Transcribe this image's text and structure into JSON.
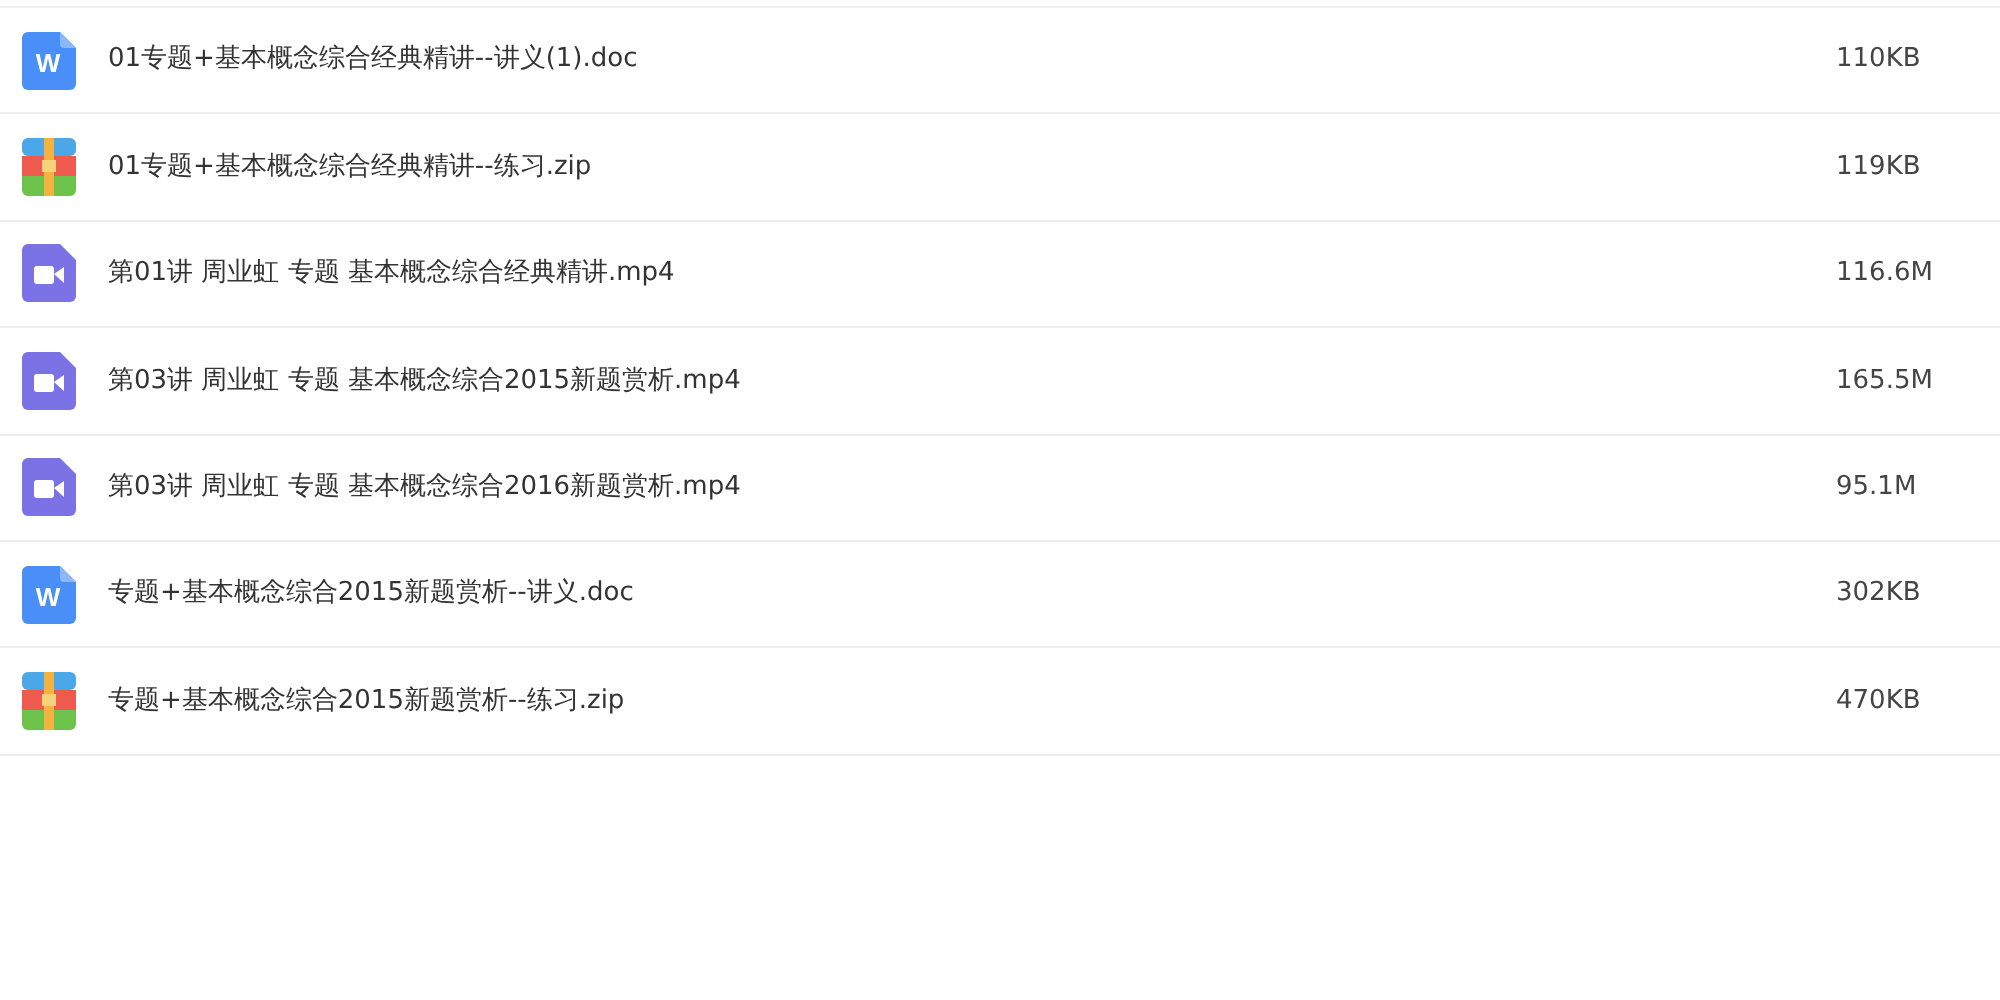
{
  "files": [
    {
      "kind": "doc",
      "icon_text": "W",
      "name": "01专题+基本概念综合经典精讲--讲义(1).doc",
      "size": "110KB"
    },
    {
      "kind": "zip",
      "name": "01专题+基本概念综合经典精讲--练习.zip",
      "size": "119KB"
    },
    {
      "kind": "video",
      "name": "第01讲 周业虹 专题 基本概念综合经典精讲.mp4",
      "size": "116.6M"
    },
    {
      "kind": "video",
      "name": "第03讲 周业虹 专题 基本概念综合2015新题赏析.mp4",
      "size": "165.5M"
    },
    {
      "kind": "video",
      "name": "第03讲 周业虹 专题 基本概念综合2016新题赏析.mp4",
      "size": "95.1M"
    },
    {
      "kind": "doc",
      "icon_text": "W",
      "name": "专题+基本概念综合2015新题赏析--讲义.doc",
      "size": "302KB"
    },
    {
      "kind": "zip",
      "name": "专题+基本概念综合2015新题赏析--练习.zip",
      "size": "470KB"
    }
  ]
}
